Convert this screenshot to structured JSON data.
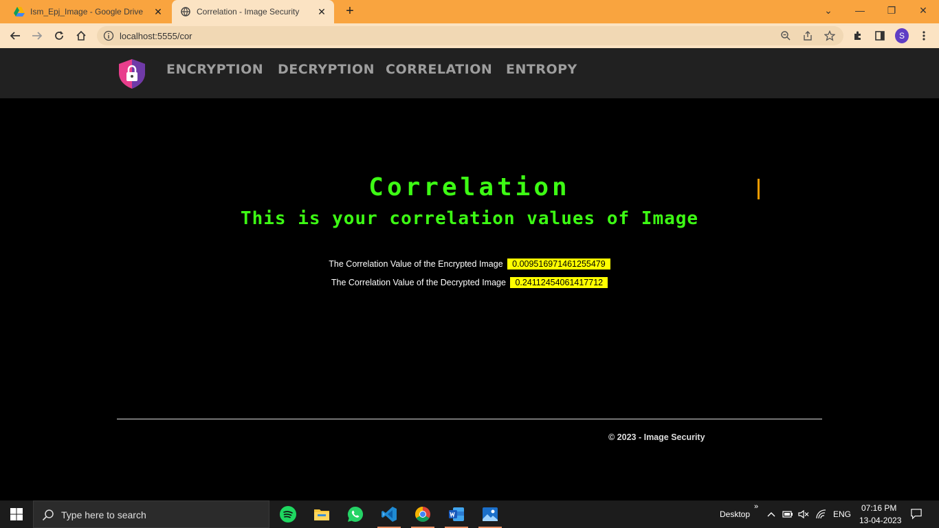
{
  "browser": {
    "tabs": [
      {
        "title": "Ism_Epj_Image - Google Drive",
        "icon": "google-drive-icon",
        "active": false
      },
      {
        "title": "Correlation - Image Security",
        "icon": "globe-icon",
        "active": true
      }
    ],
    "url": "localhost:5555/cor",
    "profile_initial": "S"
  },
  "site": {
    "nav": [
      "ENCRYPTION",
      "DECRYPTION",
      "CORRELATION",
      "ENTROPY"
    ],
    "heading": "Correlation",
    "subheading": "This is your correlation values of Image",
    "results": [
      {
        "label": "The Correlation Value of the Encrypted Image",
        "value": "0.009516971461255479"
      },
      {
        "label": "The Correlation Value of the Decrypted Image",
        "value": "0.24112454061417712"
      }
    ],
    "footer": "© 2023 - Image Security"
  },
  "taskbar": {
    "search_placeholder": "Type here to search",
    "apps": [
      "spotify-icon",
      "file-explorer-icon",
      "whatsapp-icon",
      "vscode-icon",
      "chrome-icon",
      "word-icon",
      "photos-icon"
    ],
    "desktop_label": "Desktop",
    "language": "ENG",
    "time": "07:16 PM",
    "date": "13-04-2023"
  },
  "colors": {
    "tab_strip": "#f9a43f",
    "toolbar": "#fbe3c3",
    "header_bg": "#212121",
    "neon_green": "#3dfb14",
    "highlight": "#ffff00",
    "cursor": "#f29b00"
  }
}
